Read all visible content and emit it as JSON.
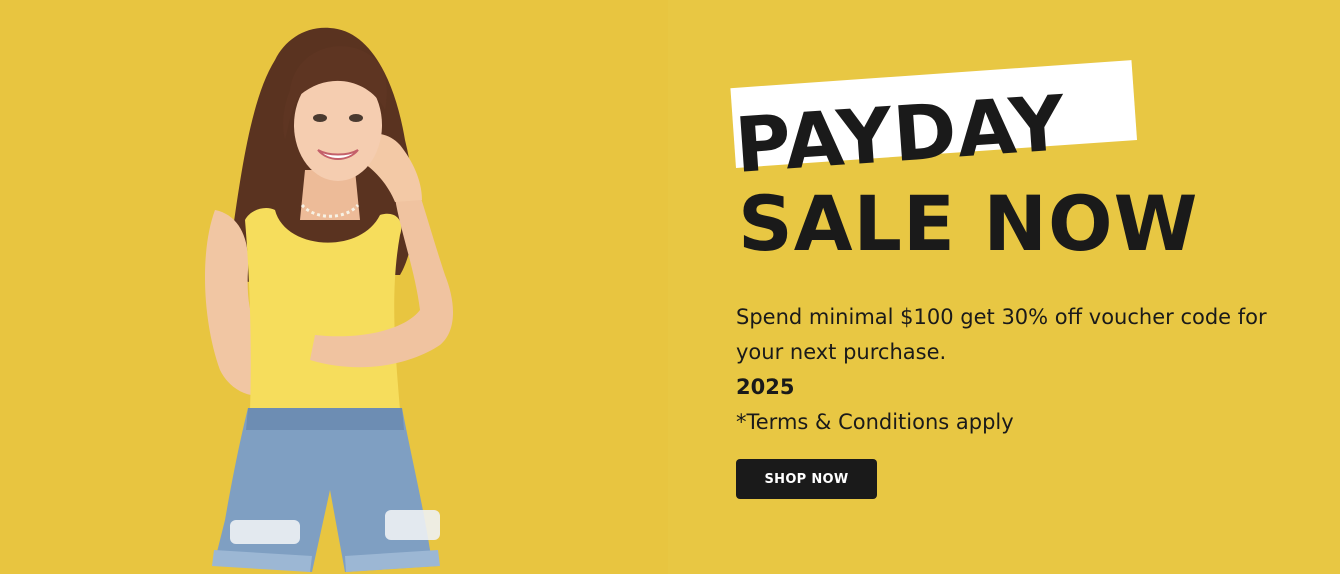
{
  "banner": {
    "headline_line_1": "PAYDAY",
    "headline_line_2": "SALE NOW",
    "description": "Spend minimal $100 get 30% off voucher code for your next purchase.",
    "year": "2025",
    "terms": "*Terms & Conditions apply",
    "cta_label": "SHOP NOW"
  },
  "colors": {
    "background": "#e8c743",
    "headline": "#1a1a1a",
    "highlight": "#ffffff",
    "button": "#1a1a1a",
    "button_text": "#ffffff"
  }
}
